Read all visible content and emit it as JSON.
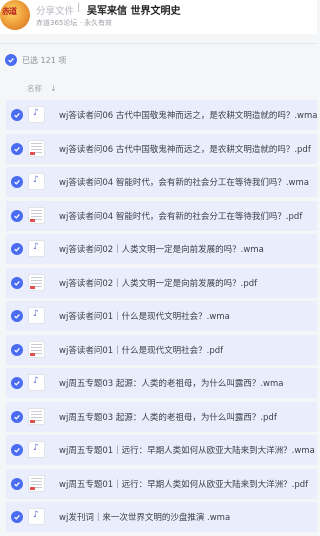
{
  "header": {
    "share_label": "分享文件",
    "separator": "|",
    "title": "吴军来信 世界文明史",
    "meta": "赤道365论坛 · 永久有效"
  },
  "selection": {
    "text": "已选 121 项"
  },
  "column": {
    "name_label": "名称",
    "sort_arrow": "↓"
  },
  "files": [
    {
      "name": "wj答读者问06 古代中国敬鬼神而远之，是农耕文明造就的吗？.wma",
      "type": "audio"
    },
    {
      "name": "wj答读者问06 古代中国敬鬼神而远之，是农耕文明造就的吗？.pdf",
      "type": "pdf"
    },
    {
      "name": "wj答读者问04 智能时代，会有新的社会分工在等待我们吗？.wma",
      "type": "audio"
    },
    {
      "name": "wj答读者问04 智能时代，会有新的社会分工在等待我们吗？.pdf",
      "type": "pdf"
    },
    {
      "name": "wj答读者问02｜人类文明一定是向前发展的吗？.wma",
      "type": "audio"
    },
    {
      "name": "wj答读者问02｜人类文明一定是向前发展的吗？.pdf",
      "type": "pdf"
    },
    {
      "name": "wj答读者问01｜什么是现代文明社会？.wma",
      "type": "audio"
    },
    {
      "name": "wj答读者问01｜什么是现代文明社会？.pdf",
      "type": "pdf"
    },
    {
      "name": "wj周五专题03 起源：人类的老祖母，为什么叫露西？.wma",
      "type": "audio"
    },
    {
      "name": "wj周五专题03 起源：人类的老祖母，为什么叫露西？.pdf",
      "type": "pdf"
    },
    {
      "name": "wj周五专题01｜远行：早期人类如何从欧亚大陆来到大洋洲？.wma",
      "type": "audio"
    },
    {
      "name": "wj周五专题01｜远行：早期人类如何从欧亚大陆来到大洋洲？.pdf",
      "type": "pdf"
    },
    {
      "name": "wj发刊词｜来一次世界文明的沙盘推演 .wma",
      "type": "audio"
    }
  ]
}
